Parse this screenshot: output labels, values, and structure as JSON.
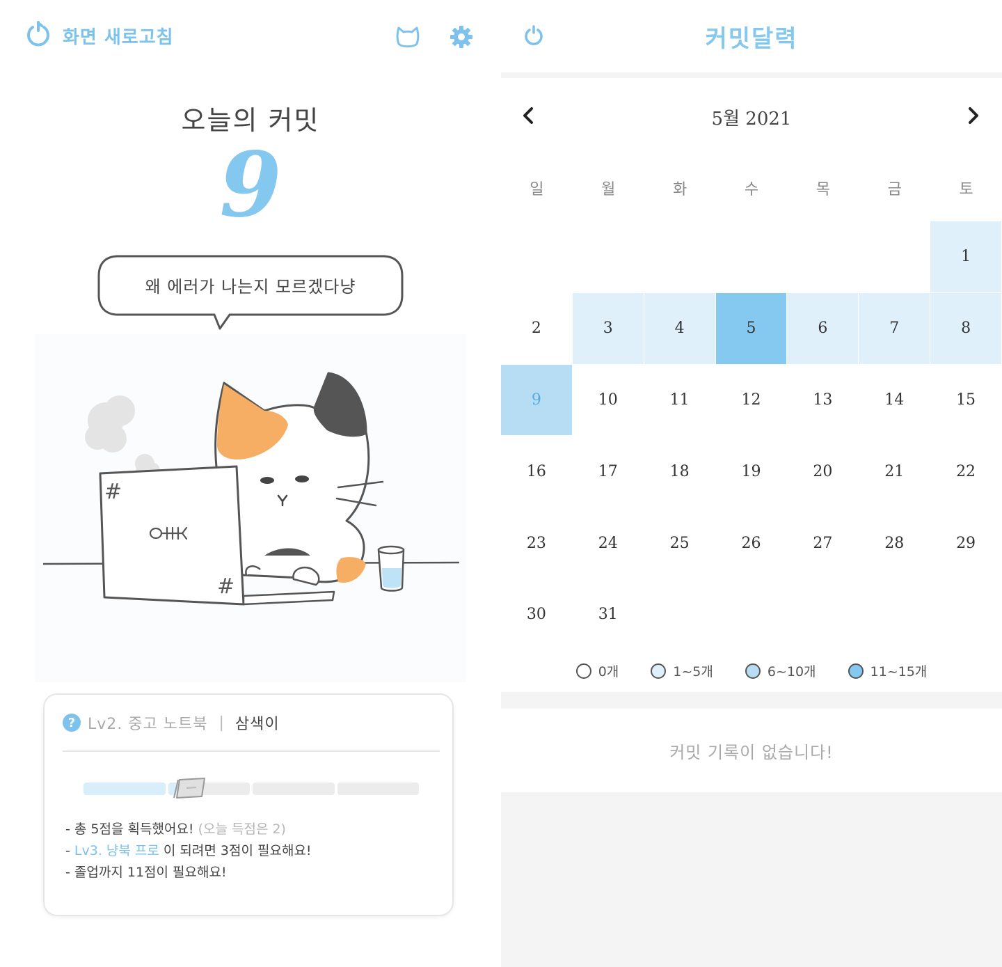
{
  "left": {
    "refresh_label": "화면 새로고침",
    "today_title": "오늘의 커밋",
    "today_count": "9",
    "speech": "왜 에러가 나는지 모르겠다냥",
    "illustration_text": [
      "#",
      "#"
    ],
    "card": {
      "level": "Lv2. 중고 노트북",
      "divider": "|",
      "nickname": "삼색이",
      "progress": 0.3,
      "line1_main": "- 총 5점을 획득했어요!",
      "line1_sub": "(오늘 득점은 2)",
      "line2_prefix": "- ",
      "line2_next": "Lv3. 냥북 프로",
      "line2_suffix": " 이 되려면 3점이 필요해요!",
      "line3": "- 졸업까지 11점이 필요해요!"
    }
  },
  "right": {
    "title": "커밋달력",
    "month_label": "5월 2021",
    "weekdays": [
      "일",
      "월",
      "화",
      "수",
      "목",
      "금",
      "토"
    ],
    "days": [
      {
        "d": "1",
        "level": 1
      },
      {
        "d": "2",
        "level": 0
      },
      {
        "d": "3",
        "level": 1
      },
      {
        "d": "4",
        "level": 1
      },
      {
        "d": "5",
        "level": 3
      },
      {
        "d": "6",
        "level": 1
      },
      {
        "d": "7",
        "level": 1
      },
      {
        "d": "8",
        "level": 1
      },
      {
        "d": "9",
        "level": 2
      },
      {
        "d": "10",
        "level": 0
      },
      {
        "d": "11",
        "level": 0
      },
      {
        "d": "12",
        "level": 0
      },
      {
        "d": "13",
        "level": 0
      },
      {
        "d": "14",
        "level": 0
      },
      {
        "d": "15",
        "level": 0
      },
      {
        "d": "16",
        "level": 0
      },
      {
        "d": "17",
        "level": 0
      },
      {
        "d": "18",
        "level": 0
      },
      {
        "d": "19",
        "level": 0
      },
      {
        "d": "20",
        "level": 0
      },
      {
        "d": "21",
        "level": 0
      },
      {
        "d": "22",
        "level": 0
      },
      {
        "d": "23",
        "level": 0
      },
      {
        "d": "24",
        "level": 0
      },
      {
        "d": "25",
        "level": 0
      },
      {
        "d": "26",
        "level": 0
      },
      {
        "d": "27",
        "level": 0
      },
      {
        "d": "28",
        "level": 0
      },
      {
        "d": "29",
        "level": 0
      },
      {
        "d": "30",
        "level": 0
      },
      {
        "d": "31",
        "level": 0
      }
    ],
    "selected_day": "9",
    "legend": [
      {
        "label": "0개",
        "color": "#ffffff"
      },
      {
        "label": "1~5개",
        "color": "#dff0fb"
      },
      {
        "label": "6~10개",
        "color": "#b7ddf5"
      },
      {
        "label": "11~15개",
        "color": "#86c9f0"
      }
    ],
    "empty_message": "커밋 기록이 없습니다!"
  },
  "colors": {
    "accent": "#7cc2ec",
    "level1": "#dff0fb",
    "level2": "#b7ddf5",
    "level3": "#86c9f0",
    "cat_orange": "#f5ae63",
    "cat_gray": "#555555"
  }
}
